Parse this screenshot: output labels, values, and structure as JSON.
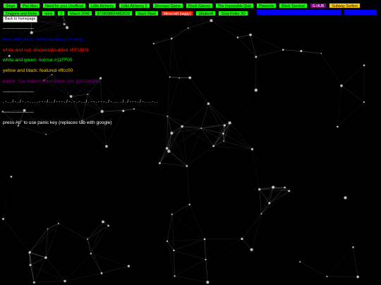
{
  "nav": {
    "row1": [
      {
        "label": "Slope",
        "style": "g"
      },
      {
        "label": "Pac-Man",
        "style": "g"
      },
      {
        "label": "Need for your Unofficial",
        "style": "g"
      },
      {
        "label": "Little Alchemy",
        "style": "g"
      },
      {
        "label": "Little Alchemy 2",
        "style": "g"
      },
      {
        "label": "Dinosaur Game",
        "style": "g"
      },
      {
        "label": "Flash Games",
        "style": "g"
      },
      {
        "label": "The Impossible Quiz",
        "style": "g"
      },
      {
        "label": "Pixwords",
        "style": "g"
      },
      {
        "label": "Block Survival",
        "style": "g"
      },
      {
        "label": "G-HUB",
        "style": "p"
      },
      {
        "label": "Subway Surfers",
        "style": "y"
      }
    ],
    "row2": [
      {
        "label": "Dragons and Blobs",
        "style": "g"
      },
      {
        "label": "tetris",
        "style": "g"
      },
      {
        "label": "2",
        "style": "g"
      },
      {
        "label": "Macro 2048",
        "style": "g"
      },
      {
        "label": "9728098664882628",
        "style": "g"
      },
      {
        "label": "Stack Blast",
        "style": "g"
      },
      {
        "label": "Minecraft (laggy)",
        "style": "r"
      },
      {
        "label": "Ultrakraft",
        "style": "g"
      },
      {
        "label": "Slow Roller 3D",
        "style": "g"
      }
    ],
    "home_label": "Back to homepage"
  },
  "legend": {
    "divider1": "--------------------",
    "blue": "blue and black: newly added (just now)",
    "red": "white and red: blocked/disabled #FF1B00",
    "green": "white and green: normal #11FF00",
    "yellow": "yellow and black: featured #ffcc00",
    "purple": "purple: has implemented panic key (just purple)",
    "divider2": "--------------------",
    "morse": ". - . . / - . / - . - . . . . - - - / . . / - - - . / - . - . - . . / . - - . - - - . / - . . . . / . / - - - . / - . . . - . .",
    "divider3": "--------------------",
    "panic": "press #p\" to use panic key (replaces tab with google)"
  },
  "colors": {
    "green": "#11ff00",
    "red": "#ff1b00",
    "yellow": "#ffcc00",
    "purple": "#800080",
    "blue": "#0000ff"
  }
}
